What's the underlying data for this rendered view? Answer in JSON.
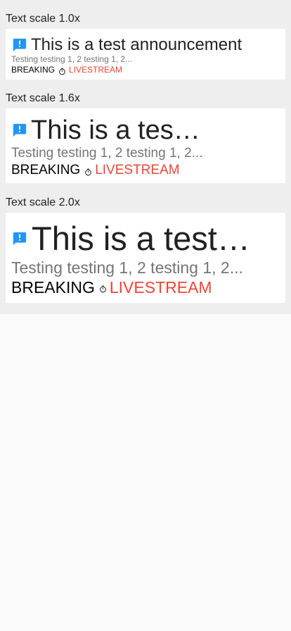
{
  "colors": {
    "icon_blue": "#2196f3",
    "live_red": "#f44336",
    "title": "#212121",
    "subtitle": "#757575"
  },
  "sections": [
    {
      "label": "Text scale 1.0x",
      "title": "This is a test announcement",
      "subtitle": "Testing testing 1, 2 testing 1, 2...",
      "tag_breaking": "BREAKING",
      "tag_live": "LIVESTREAM",
      "icon": "announcement-icon",
      "tag_icon": "timer-icon"
    },
    {
      "label": "Text scale 1.6x",
      "title": "This is a test announcement",
      "subtitle": "Testing testing 1, 2 testing 1, 2...",
      "tag_breaking": "BREAKING",
      "tag_live": "LIVESTREAM",
      "icon": "announcement-icon",
      "tag_icon": "timer-icon"
    },
    {
      "label": "Text scale 2.0x",
      "title": "This is a test announcement",
      "subtitle": "Testing testing 1, 2 testing 1, 2...",
      "tag_breaking": "BREAKING",
      "tag_live": "LIVESTREAM",
      "icon": "announcement-icon",
      "tag_icon": "timer-icon"
    }
  ]
}
